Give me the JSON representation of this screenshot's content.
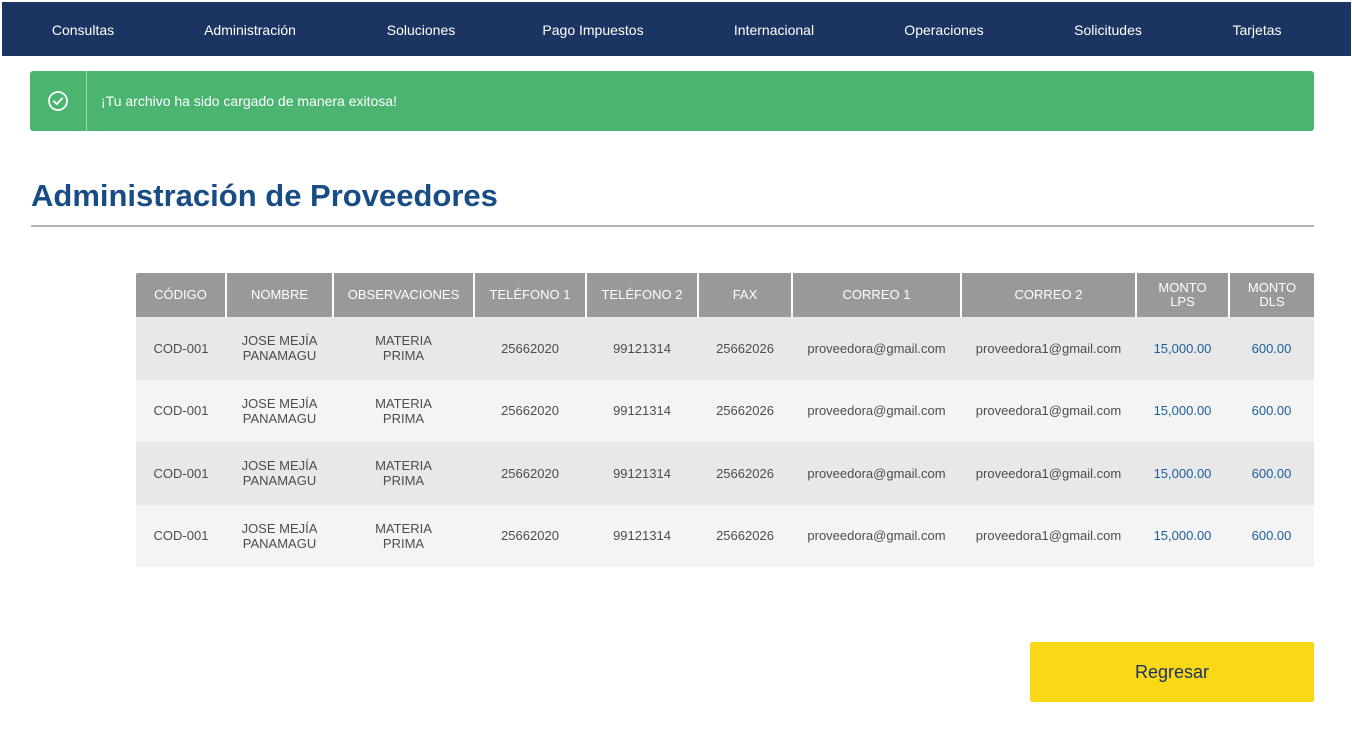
{
  "nav": {
    "items": [
      {
        "label": "Consultas"
      },
      {
        "label": "Administración"
      },
      {
        "label": "Soluciones"
      },
      {
        "label": "Pago Impuestos"
      },
      {
        "label": "Internacional"
      },
      {
        "label": "Operaciones"
      },
      {
        "label": "Solicitudes"
      },
      {
        "label": "Tarjetas"
      }
    ]
  },
  "alert": {
    "message": "¡Tu archivo ha sido cargado de manera exitosa!",
    "icon": "check-circle-icon",
    "color": "#4bb470"
  },
  "page": {
    "title": "Administración de Proveedores"
  },
  "table": {
    "headers": [
      "CÓDIGO",
      "NOMBRE",
      "OBSERVACIONES",
      "TELÉFONO 1",
      "TELÉFONO 2",
      "FAX",
      "CORREO 1",
      "CORREO 2",
      "MONTO\nLPS",
      "MONTO\nDLS"
    ],
    "rows": [
      {
        "codigo": "COD-001",
        "nombre": "JOSE MEJÍA\nPANAMAGU",
        "observaciones": "MATERIA\nPRIMA",
        "telefono1": "25662020",
        "telefono2": "99121314",
        "fax": "25662026",
        "correo1": "proveedora@gmail.com",
        "correo2": "proveedora1@gmail.com",
        "monto_lps": "15,000.00",
        "monto_dls": "600.00"
      },
      {
        "codigo": "COD-001",
        "nombre": "JOSE MEJÍA\nPANAMAGU",
        "observaciones": "MATERIA\nPRIMA",
        "telefono1": "25662020",
        "telefono2": "99121314",
        "fax": "25662026",
        "correo1": "proveedora@gmail.com",
        "correo2": "proveedora1@gmail.com",
        "monto_lps": "15,000.00",
        "monto_dls": "600.00"
      },
      {
        "codigo": "COD-001",
        "nombre": "JOSE MEJÍA\nPANAMAGU",
        "observaciones": "MATERIA\nPRIMA",
        "telefono1": "25662020",
        "telefono2": "99121314",
        "fax": "25662026",
        "correo1": "proveedora@gmail.com",
        "correo2": "proveedora1@gmail.com",
        "monto_lps": "15,000.00",
        "monto_dls": "600.00"
      },
      {
        "codigo": "COD-001",
        "nombre": "JOSE MEJÍA\nPANAMAGU",
        "observaciones": "MATERIA\nPRIMA",
        "telefono1": "25662020",
        "telefono2": "99121314",
        "fax": "25662026",
        "correo1": "proveedora@gmail.com",
        "correo2": "proveedora1@gmail.com",
        "monto_lps": "15,000.00",
        "monto_dls": "600.00"
      }
    ]
  },
  "actions": {
    "back_label": "Regresar"
  },
  "colors": {
    "nav_bg": "#1b3461",
    "title": "#174d84",
    "money": "#1d5f9c",
    "button": "#fad816"
  }
}
